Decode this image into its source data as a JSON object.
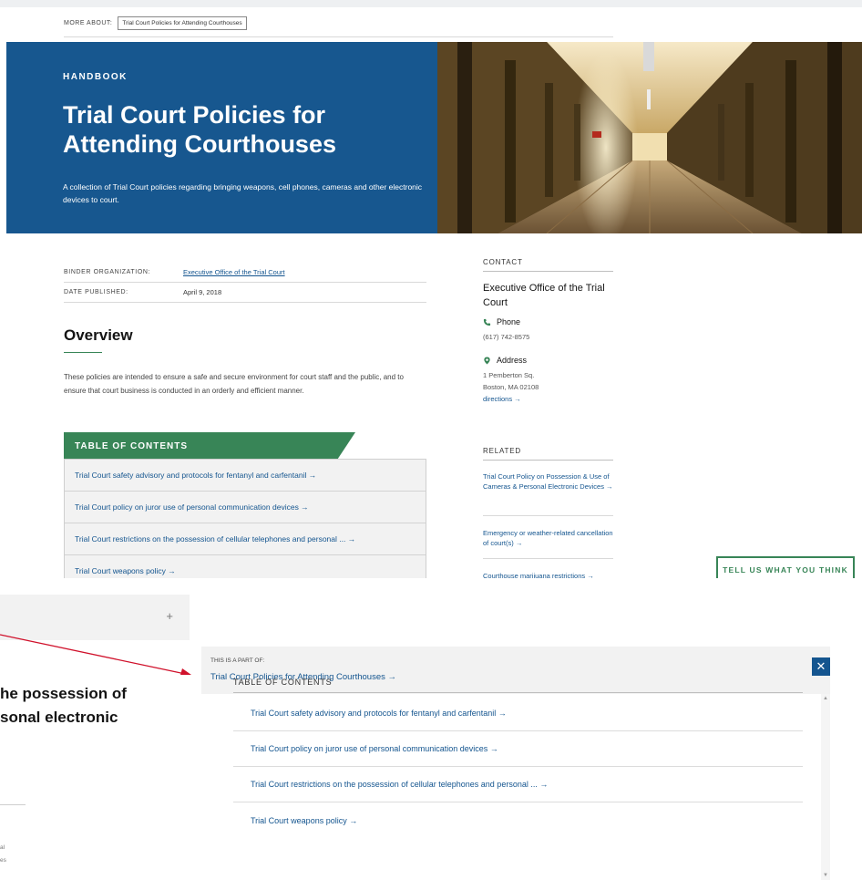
{
  "top": {
    "more_about_label": "MORE ABOUT:",
    "more_about_tag": "Trial Court Policies for Attending Courthouses",
    "hero": {
      "kicker": "HANDBOOK",
      "title": "Trial Court Policies for Attending Courthouses",
      "description": "A collection of Trial Court policies regarding bringing weapons, cell phones, cameras and other electronic devices to court."
    },
    "meta": [
      {
        "key": "BINDER ORGANIZATION:",
        "value": "Executive Office of the Trial Court"
      },
      {
        "key": "DATE PUBLISHED:",
        "value": "April 9, 2018"
      }
    ],
    "overview": {
      "heading": "Overview",
      "text": "These policies are intended to ensure a safe and secure environment for court staff and the public, and to ensure that court business is conducted in an orderly and efficient manner."
    },
    "toc": {
      "heading": "TABLE OF CONTENTS",
      "items": [
        "Trial Court safety advisory and protocols for fentanyl and carfentanil →",
        "Trial Court policy on juror use of personal communication devices →",
        "Trial Court restrictions on the possession of cellular telephones and personal ... →",
        "Trial Court weapons policy →"
      ]
    },
    "contact": {
      "label": "CONTACT",
      "org": "Executive Office of the Trial Court",
      "phone_label": "Phone",
      "phone": "(617) 742-8575",
      "address_label": "Address",
      "address_line1": "1 Pemberton Sq.",
      "address_line2": "Boston, MA 02108",
      "directions": "directions →"
    },
    "related": {
      "label": "RELATED",
      "items": [
        "Trial Court Policy on Possession & Use of Cameras & Personal Electronic Devices →",
        "Emergency or weather-related cancellation of court(s) →",
        "Courthouse marijuana restrictions →"
      ]
    },
    "feedback": "TELL US WHAT YOU THINK"
  },
  "bottom": {
    "left_heading": "he possession of\nsonal electronic",
    "left_frags": [
      "al",
      "es"
    ],
    "plus": "+",
    "panel": {
      "part_of_label": "THIS IS A PART OF:",
      "part_of_title": "Trial Court Policies for Attending Courthouses →",
      "close": "✕",
      "toc_label": "TABLE OF CONTENTS",
      "toc_items": [
        "Trial Court safety advisory and protocols for fentanyl and carfentanil →",
        "Trial Court policy on juror use of personal communication devices →",
        "Trial Court restrictions on the possession of cellular telephones and personal ... →",
        "Trial Court weapons policy →"
      ]
    }
  },
  "colors": {
    "hero_blue": "#17578f",
    "accent_green": "#388557",
    "link_blue": "#14558f",
    "annotation_red": "#d0112b"
  }
}
